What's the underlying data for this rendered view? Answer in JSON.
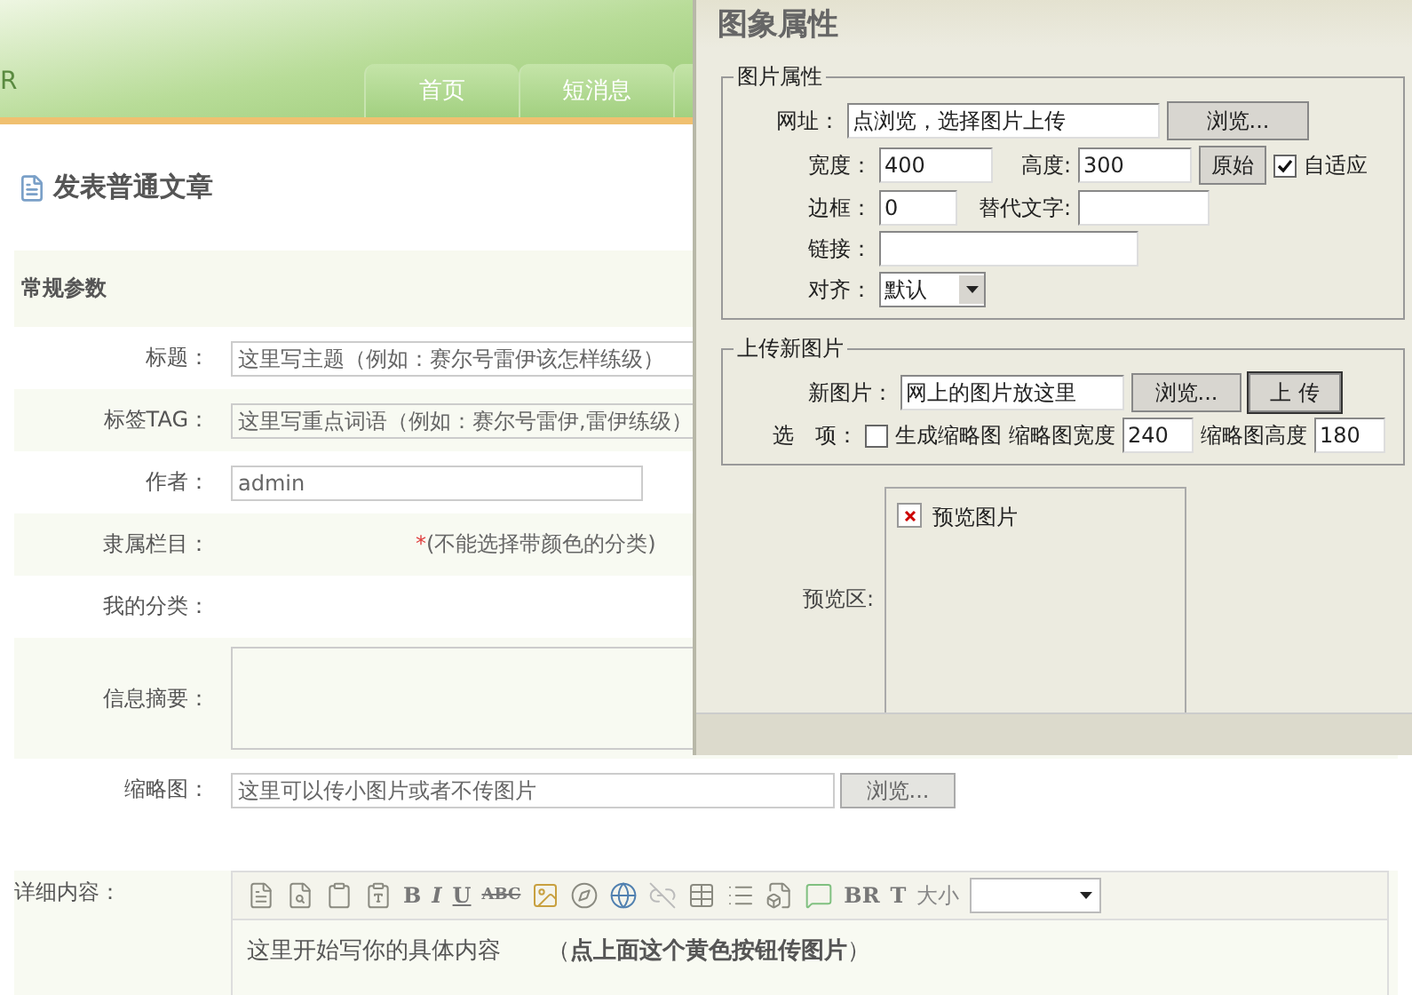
{
  "header": {
    "logo_text": "R",
    "nav_tabs": [
      {
        "label": "首页"
      },
      {
        "label": "短消息"
      }
    ]
  },
  "page_title": "发表普通文章",
  "section_title": "常规参数",
  "fields": [
    {
      "kind": "input",
      "label": "标题：",
      "value": "这里写主题（例如：赛尔号雷伊该怎样练级）"
    },
    {
      "kind": "input",
      "label": "标签TAG：",
      "value": "这里写重点词语（例如：赛尔号雷伊,雷伊练级）"
    },
    {
      "kind": "short_input",
      "label": "作者：",
      "value": "admin"
    },
    {
      "kind": "note",
      "label": "隶属栏目：",
      "mark": "*",
      "note": "(不能选择带颜色的分类)"
    },
    {
      "kind": "empty",
      "label": "我的分类："
    },
    {
      "kind": "textarea",
      "label": "信息摘要："
    },
    {
      "kind": "file",
      "label": "缩略图：",
      "value": "这里可以传小图片或者不传图片",
      "button": "浏览..."
    }
  ],
  "editor": {
    "label": "详细内容：",
    "text_buttons": {
      "bold": "B",
      "italic": "I",
      "underline": "U",
      "strike": "ABC",
      "break": "BR",
      "text_color": "T"
    },
    "size_label": "大小",
    "content": "这里开始写你的具体内容　　（**点上面这个黄色按钮传图片**）"
  },
  "dialog": {
    "title": "图象属性",
    "image_props": {
      "legend": "图片属性",
      "url_label": "网址：",
      "url_value": "点浏览，选择图片上传",
      "browse": "浏览...",
      "width_label": "宽度：",
      "width_value": "400",
      "height_label": "高度:",
      "height_value": "300",
      "original": "原始",
      "autofit": {
        "label": "自适应",
        "checked": true
      },
      "border_label": "边框：",
      "border_value": "0",
      "alt_label": "替代文字:",
      "link_label": "链接：",
      "align_label": "对齐：",
      "align_value": "默认"
    },
    "upload": {
      "legend": "上传新图片",
      "new_label": "新图片：",
      "new_value": "网上的图片放这里",
      "browse": "浏览...",
      "upload": "上 传",
      "options_label": "选　项：",
      "thumb": {
        "label": "生成缩略图",
        "checked": false
      },
      "thumb_w_label": "缩略图宽度",
      "thumb_w": "240",
      "thumb_h_label": "缩略图高度",
      "thumb_h": "180"
    },
    "preview": {
      "label": "预览区:",
      "image_text": "预览图片"
    }
  }
}
